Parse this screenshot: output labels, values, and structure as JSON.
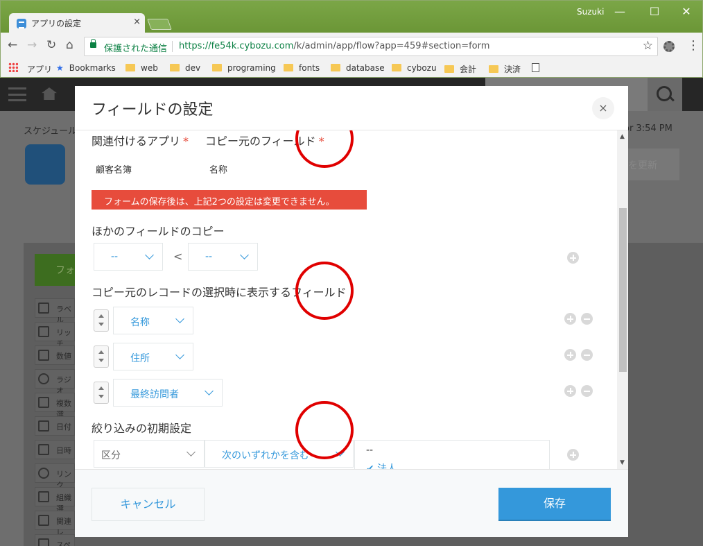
{
  "browser": {
    "tab_title": "アプリの設定",
    "tab_close": "×",
    "user_name": "Suzuki",
    "window_minimize": "—",
    "window_maximize": "☐",
    "window_close": "✕",
    "secure_label": "保護された通信",
    "url_host": "https://fe54k.cybozu.com",
    "url_path": "/k/admin/app/flow?app=459#section=form",
    "bookmarks": [
      "アプリ",
      "Bookmarks",
      "web",
      "dev",
      "programing",
      "fonts",
      "database",
      "cybozu",
      "会計",
      "決済"
    ]
  },
  "background_page": {
    "breadcrumb": "スケジュール",
    "time_text": "or  3:54 PM",
    "update_label": "を更新",
    "palette_header": "フォ",
    "palette_items": [
      "ラベル",
      "リッチ",
      "数値",
      "ラジオ",
      "複数選",
      "日付",
      "日時",
      "リンク",
      "組織選",
      "関連レ",
      "スペー"
    ]
  },
  "modal": {
    "title": "フィールドの設定",
    "close": "×",
    "related_app_label": "関連付けるアプリ",
    "copy_source_label": "コピー元のフィールド",
    "required_mark": "*",
    "related_app_value": "顧客名簿",
    "copy_source_value": "名称",
    "warning": "フォームの保存後は、上記2つの設定は変更できません。",
    "other_copy_label": "ほかのフィールドのコピー",
    "other_copy_left": "--",
    "other_copy_arrow": "<",
    "other_copy_right": "--",
    "display_fields_label": "コピー元のレコードの選択時に表示するフィールド",
    "display_fields": [
      "名称",
      "住所",
      "最終訪問者"
    ],
    "filter_label": "絞り込みの初期設定",
    "filter_field": "区分",
    "filter_condition": "次のいずれかを含む",
    "filter_values_header": "--",
    "filter_values_option": "✔ 法人",
    "cancel_button": "キャンセル",
    "save_button": "保存"
  },
  "colors": {
    "accent": "#3498db",
    "error": "#e74c3c",
    "annotation": "#e00000",
    "titlebar": "#6f9a3a"
  }
}
